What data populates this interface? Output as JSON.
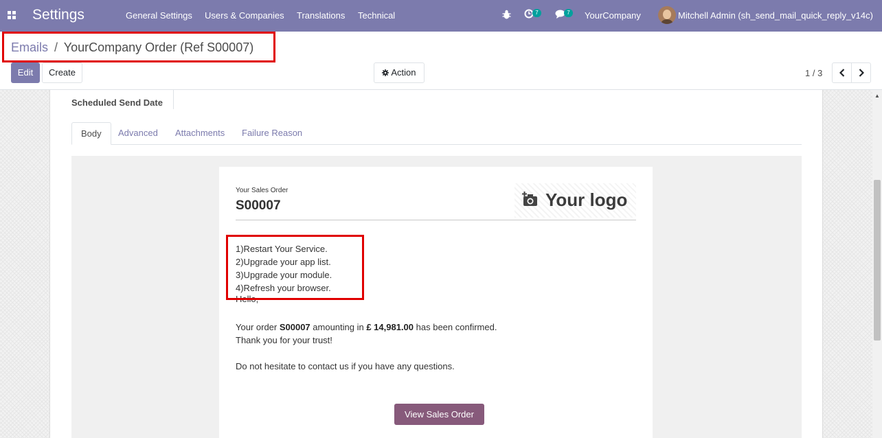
{
  "navbar": {
    "brand": "Settings",
    "menu": [
      "General Settings",
      "Users & Companies",
      "Translations",
      "Technical"
    ],
    "activity_count": "7",
    "message_count": "7",
    "company": "YourCompany",
    "user": "Mitchell Admin (sh_send_mail_quick_reply_v14c)",
    "accent_color": "#7c7bad"
  },
  "breadcrumb": {
    "parent": "Emails",
    "separator": "/",
    "current": "YourCompany Order (Ref S00007)"
  },
  "toolbar": {
    "edit_label": "Edit",
    "create_label": "Create",
    "action_label": "Action",
    "pager": "1 / 3"
  },
  "form": {
    "scheduled_label": "Scheduled Send Date",
    "tabs": [
      "Body",
      "Advanced",
      "Attachments",
      "Failure Reason"
    ],
    "active_tab": "Body"
  },
  "mail": {
    "header_small": "Your Sales Order",
    "order_number": "S00007",
    "logo_text": "Your logo",
    "steps": [
      "1)Restart Your Service.",
      "2)Upgrade your app list.",
      "3)Upgrade your module.",
      "4)Refresh your browser."
    ],
    "greeting": "Hello,",
    "confirm_prefix": "Your order ",
    "confirm_order": "S00007",
    "confirm_mid": " amounting in ",
    "confirm_amount": "£ 14,981.00",
    "confirm_suffix": " has been confirmed.",
    "thanks": "Thank you for your trust!",
    "contact": "Do not hesitate to contact us if you have any questions.",
    "button_label": "View Sales Order",
    "button_color": "#875a7b"
  },
  "highlight_color": "#e00000"
}
